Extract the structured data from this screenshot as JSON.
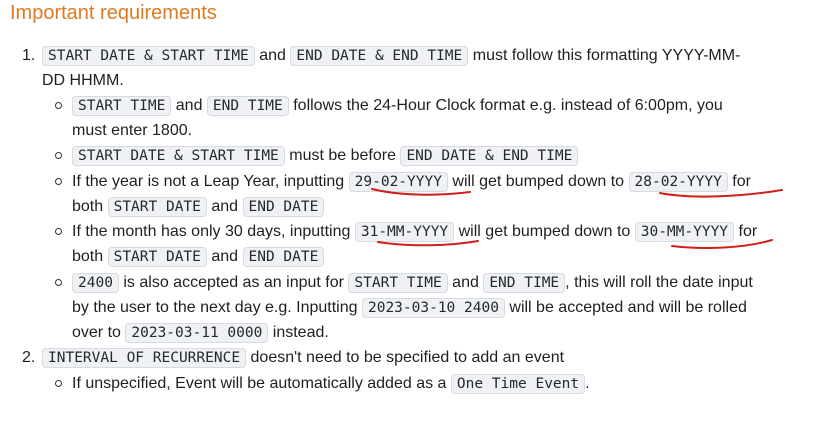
{
  "heading": "Important requirements",
  "items": {
    "i1": {
      "num": "1.",
      "c1": "START DATE & START TIME",
      "t1": "and",
      "c2": "END DATE & END TIME",
      "t2": "must follow this formatting YYYY-MM-",
      "t3": "DD HHMM.",
      "s1": {
        "c1": "START TIME",
        "t1": "and",
        "c2": "END TIME",
        "t2": "follows the 24-Hour Clock format e.g. instead of 6:00pm, you",
        "t3": "must enter 1800."
      },
      "s2": {
        "c1": "START DATE & START TIME",
        "t1": "must be before",
        "c2": "END DATE & END TIME"
      },
      "s3": {
        "t1": "If the year is not a Leap Year, inputting",
        "c1": "29-02-YYYY",
        "t2": "will get bumped down to",
        "c2": "28-02-YYYY",
        "t3": "for",
        "t4": "both",
        "c3": "START DATE",
        "t5": "and",
        "c4": "END DATE"
      },
      "s4": {
        "t1": "If the month has only 30 days, inputting",
        "c1": "31-MM-YYYY",
        "t2": "will get bumped down to",
        "c2": "30-MM-YYYY",
        "t3": "for",
        "t4": "both",
        "c3": "START DATE",
        "t5": "and",
        "c4": "END DATE"
      },
      "s5": {
        "c1": "2400",
        "t1": "is also accepted as an input for",
        "c2": "START TIME",
        "t2": "and",
        "c3": "END TIME",
        "t3": ", this will roll the date input",
        "t4": "by the user to the next day e.g. Inputting",
        "c4": "2023-03-10 2400",
        "t5": "will be accepted and will be rolled",
        "t6": "over to",
        "c5": "2023-03-11 0000",
        "t7": "instead."
      }
    },
    "i2": {
      "num": "2.",
      "c1": "INTERVAL OF RECURRENCE",
      "t1": "doesn't need to be specified to add an event",
      "s1": {
        "t1": "If unspecified, Event will be automatically added as a",
        "c1": "One Time Event",
        "t2": "."
      }
    }
  },
  "annotation_color": "#d0201a"
}
